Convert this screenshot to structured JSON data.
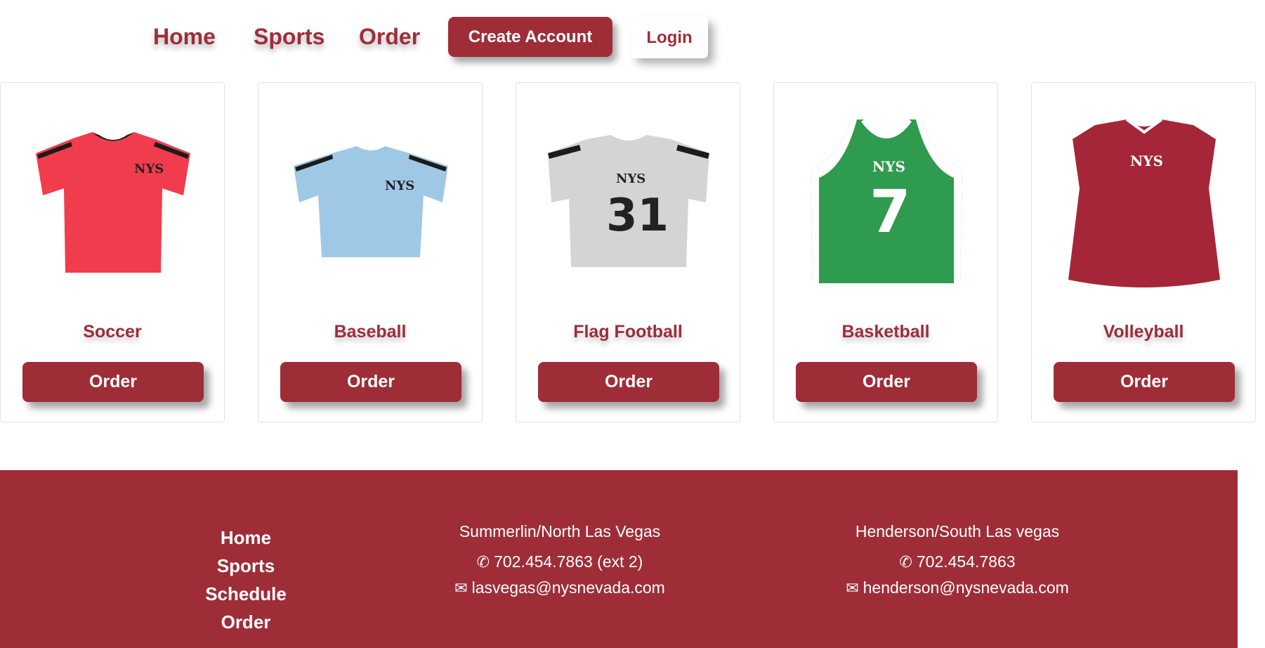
{
  "nav": {
    "home": "Home",
    "sports": "Sports",
    "order": "Order",
    "create_account": "Create Account",
    "login": "Login"
  },
  "cards": [
    {
      "title": "Soccer",
      "button": "Order",
      "jersey_color": "#f03c4c",
      "trim_color": "#1b1b1b"
    },
    {
      "title": "Baseball",
      "button": "Order",
      "jersey_color": "#9fc8e6",
      "trim_color": "#1b1b1b"
    },
    {
      "title": "Flag Football",
      "button": "Order",
      "jersey_color": "#d4d4d4",
      "trim_color": "#1b1b1b",
      "number": "31"
    },
    {
      "title": "Basketball",
      "button": "Order",
      "jersey_color": "#2f9b4f",
      "trim_color": "#ffffff",
      "number": "7"
    },
    {
      "title": "Volleyball",
      "button": "Order",
      "jersey_color": "#a52638",
      "trim_color": "#ffffff"
    }
  ],
  "footer": {
    "links": [
      "Home",
      "Sports",
      "Schedule",
      "Order"
    ],
    "locations": [
      {
        "title": "Summerlin/North Las Vegas",
        "phone": "702.454.7863 (ext 2)",
        "email": "lasvegas@nysnevada.com"
      },
      {
        "title": "Henderson/South Las vegas",
        "phone": "702.454.7863",
        "email": "henderson@nysnevada.com"
      }
    ]
  },
  "colors": {
    "brand": "#9e2d38",
    "background": "#ffffff"
  },
  "icons": {
    "phone": "phone-icon",
    "email": "envelope-icon"
  }
}
